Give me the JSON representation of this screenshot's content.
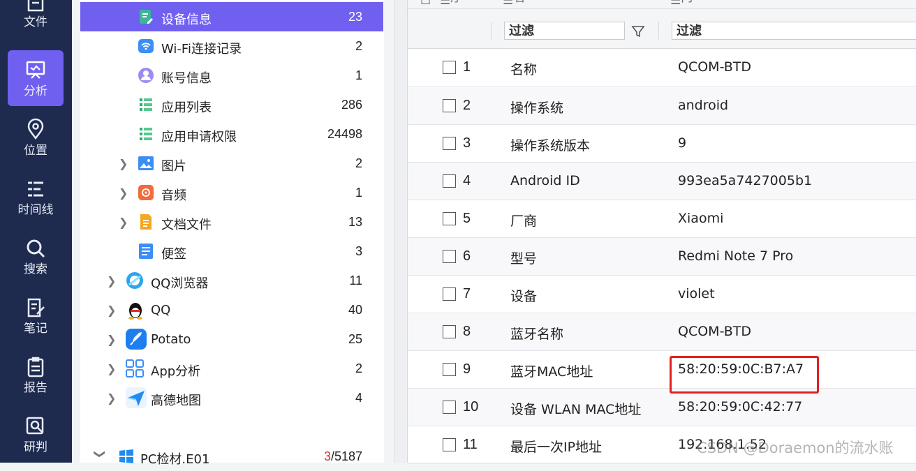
{
  "rail": {
    "items": [
      {
        "label": "文件",
        "icon": "file-icon",
        "active": false
      },
      {
        "label": "分析",
        "icon": "monitor-icon",
        "active": true
      },
      {
        "label": "位置",
        "icon": "location-pin-icon",
        "active": false
      },
      {
        "label": "时间线",
        "icon": "timeline-icon",
        "active": false
      },
      {
        "label": "搜索",
        "icon": "search-icon",
        "active": false
      },
      {
        "label": "笔记",
        "icon": "notes-edit-icon",
        "active": false
      },
      {
        "label": "报告",
        "icon": "report-icon",
        "active": false
      },
      {
        "label": "研判",
        "icon": "analysis-search-icon",
        "active": false
      }
    ]
  },
  "tree": {
    "items": [
      {
        "label": "设备信息",
        "count": "23",
        "icon": "device-info-icon",
        "selected": true
      },
      {
        "label": "Wi-Fi连接记录",
        "count": "2",
        "icon": "wifi-icon"
      },
      {
        "label": "账号信息",
        "count": "1",
        "icon": "account-icon"
      },
      {
        "label": "应用列表",
        "count": "286",
        "icon": "app-list-icon"
      },
      {
        "label": "应用申请权限",
        "count": "24498",
        "icon": "permissions-icon"
      },
      {
        "label": "图片",
        "count": "2",
        "icon": "image-icon"
      },
      {
        "label": "音频",
        "count": "1",
        "icon": "audio-icon"
      },
      {
        "label": "文档文件",
        "count": "13",
        "icon": "document-icon"
      },
      {
        "label": "便签",
        "count": "3",
        "icon": "memo-icon"
      },
      {
        "label": "QQ浏览器",
        "count": "11",
        "icon": "qq-browser-icon"
      },
      {
        "label": "QQ",
        "count": "40",
        "icon": "qq-penguin-icon"
      },
      {
        "label": "Potato",
        "count": "25",
        "icon": "potato-rocket-icon"
      },
      {
        "label": "App分析",
        "count": "2",
        "icon": "app-grid-icon"
      },
      {
        "label": "高德地图",
        "count": "4",
        "icon": "amap-icon"
      }
    ],
    "pc_node": {
      "label": "PC检材.E01",
      "count_err": "3",
      "count_total": "/5187",
      "icon": "windows-icon"
    }
  },
  "table": {
    "headers": [
      "序号",
      "名称",
      "内容"
    ],
    "filters": [
      "过滤",
      "过滤"
    ],
    "rows": [
      {
        "idx": "1",
        "name": "名称",
        "value": "QCOM-BTD"
      },
      {
        "idx": "2",
        "name": "操作系统",
        "value": "android"
      },
      {
        "idx": "3",
        "name": "操作系统版本",
        "value": "9"
      },
      {
        "idx": "4",
        "name": "Android ID",
        "value": "993ea5a7427005b1"
      },
      {
        "idx": "5",
        "name": "厂商",
        "value": "Xiaomi"
      },
      {
        "idx": "6",
        "name": "型号",
        "value": "Redmi Note 7 Pro"
      },
      {
        "idx": "7",
        "name": "设备",
        "value": "violet"
      },
      {
        "idx": "8",
        "name": "蓝牙名称",
        "value": "QCOM-BTD"
      },
      {
        "idx": "9",
        "name": "蓝牙MAC地址",
        "value": "58:20:59:0C:B7:A7"
      },
      {
        "idx": "10",
        "name": "设备 WLAN MAC地址",
        "value": "58:20:59:0C:42:77"
      },
      {
        "idx": "11",
        "name": "最后一次IP地址",
        "value": "192.168.1.52"
      }
    ]
  },
  "watermark": "CSDN @Doraemon的流水账",
  "colors": {
    "rail_bg": "#1e2a4e",
    "accent": "#7060f0",
    "highlight": "#e02020"
  }
}
